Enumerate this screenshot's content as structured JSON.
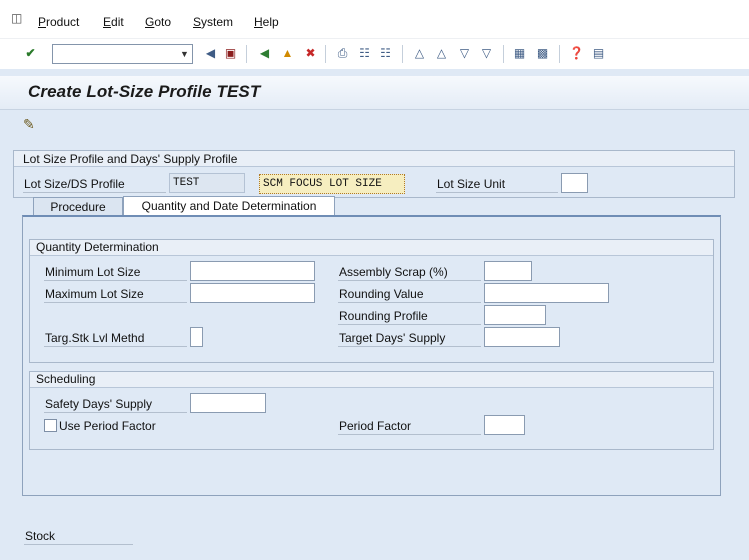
{
  "menu": {
    "items": [
      {
        "label": "Product"
      },
      {
        "label": "Edit"
      },
      {
        "label": "Goto"
      },
      {
        "label": "System"
      },
      {
        "label": "Help"
      }
    ]
  },
  "page": {
    "title": "Create Lot-Size Profile TEST"
  },
  "header": {
    "group_title": "Lot Size Profile and Days' Supply Profile",
    "profile_label": "Lot Size/DS Profile",
    "profile_value": "TEST",
    "profile_desc": "SCM FOCUS LOT SIZE",
    "unit_label": "Lot Size Unit",
    "unit_value": ""
  },
  "tabs": [
    {
      "label": "Procedure",
      "active": false
    },
    {
      "label": "Quantity and Date Determination",
      "active": true
    }
  ],
  "quantity": {
    "title": "Quantity Determination",
    "min_lot_label": "Minimum Lot Size",
    "min_lot_value": "",
    "max_lot_label": "Maximum Lot Size",
    "max_lot_value": "",
    "targ_stk_label": "Targ.Stk Lvl Methd",
    "targ_stk_value": "",
    "assembly_scrap_label": "Assembly Scrap (%)",
    "assembly_scrap_value": "",
    "rounding_value_label": "Rounding Value",
    "rounding_value_value": "",
    "rounding_profile_label": "Rounding Profile",
    "rounding_profile_value": "",
    "target_days_label": "Target Days' Supply",
    "target_days_value": ""
  },
  "scheduling": {
    "title": "Scheduling",
    "safety_days_label": "Safety Days' Supply",
    "safety_days_value": "",
    "use_period_label": "Use Period Factor",
    "use_period_checked": false,
    "period_factor_label": "Period Factor",
    "period_factor_value": ""
  },
  "bottom": {
    "stock_label": "Stock"
  },
  "icons": {
    "menu": "window-menu-icon",
    "enter": "enter-check-icon",
    "back": "back-icon",
    "save": "save-icon",
    "exit": "exit-icon",
    "cancel": "cancel-icon"
  }
}
